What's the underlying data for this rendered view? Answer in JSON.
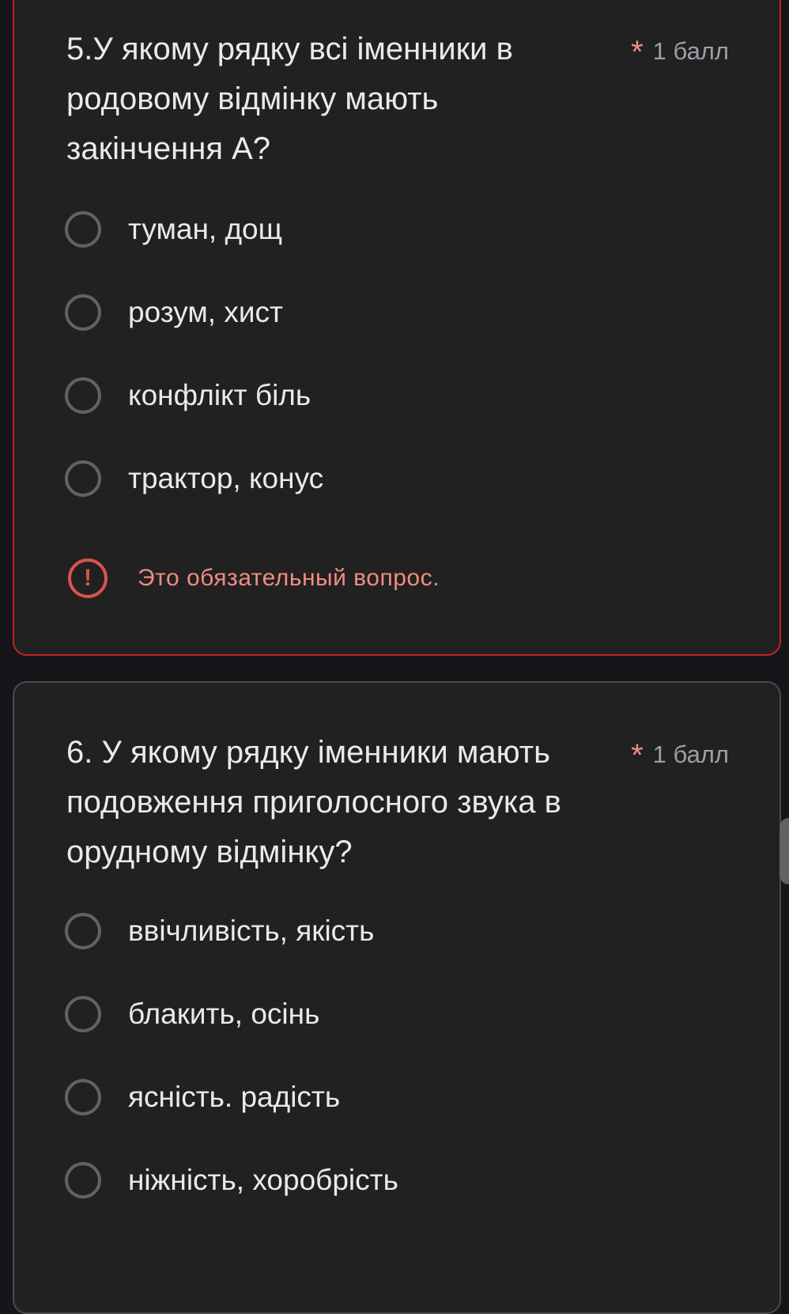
{
  "questions": [
    {
      "title": "5.У якому рядку всі іменники в родовому відмінку мають закінчення А?",
      "required_mark": "*",
      "points": "1 балл",
      "options": [
        "туман, дощ",
        "розум, хист",
        "конфлікт біль",
        "трактор, конус"
      ],
      "error": "Это обязательный вопрос.",
      "error_icon": "!"
    },
    {
      "title": "6. У якому рядку іменники мають подовження приголосного звука в орудному відмінку?",
      "required_mark": "*",
      "points": "1 балл",
      "options": [
        "ввічливість, якість",
        "блакить, осінь",
        "ясність. радість",
        "ніжність, хоробрість"
      ]
    }
  ],
  "colors": {
    "background": "#16151a",
    "card": "#212122",
    "error_border": "#c5221f",
    "error_text": "#f28b82",
    "radio_border": "#5f6368"
  }
}
